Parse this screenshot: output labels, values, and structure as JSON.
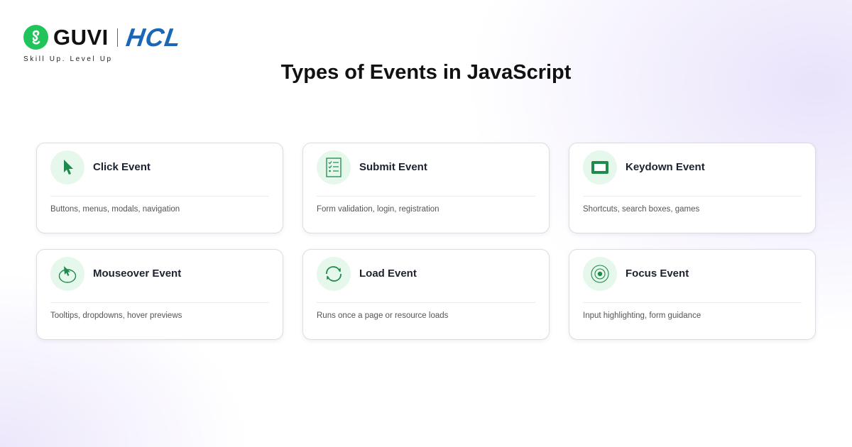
{
  "logo": {
    "brand": "GUVI",
    "partner": "HCL",
    "tagline": "Skill Up. Level Up",
    "brand_color": "#21c45a",
    "partner_color": "#1a67b8"
  },
  "title": "Types of Events in JavaScript",
  "accent_color": "#1e8a4c",
  "cards": [
    {
      "title": "Click Event",
      "description": "Buttons, menus, modals, navigation",
      "icon": "cursor-icon"
    },
    {
      "title": "Submit Event",
      "description": "Form validation, login, registration",
      "icon": "checklist-icon"
    },
    {
      "title": "Keydown Event",
      "description": "Shortcuts, search boxes, games",
      "icon": "keyboard-icon"
    },
    {
      "title": "Mouseover Event",
      "description": "Tooltips, dropdowns, hover previews",
      "icon": "hover-cursor-icon"
    },
    {
      "title": "Load Event",
      "description": "Runs once a page or resource loads",
      "icon": "refresh-icon"
    },
    {
      "title": "Focus Event",
      "description": "Input highlighting, form guidance",
      "icon": "target-icon"
    }
  ]
}
